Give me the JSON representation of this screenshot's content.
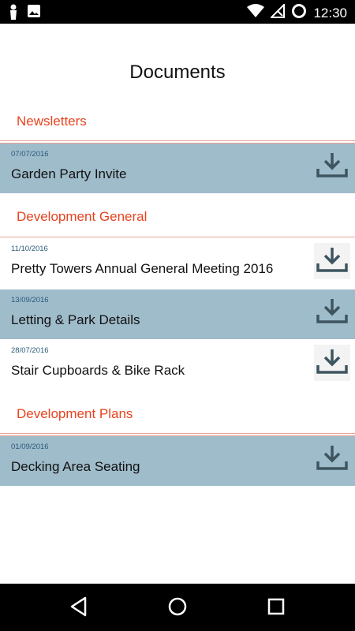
{
  "status_bar": {
    "time": "12:30",
    "left_icons": [
      "person-icon",
      "image-icon"
    ],
    "right_icons": [
      "wifi-icon",
      "no-signal-icon",
      "sync-icon"
    ]
  },
  "page": {
    "title": "Documents"
  },
  "sections": [
    {
      "title": "Newsletters",
      "documents": [
        {
          "date": "07/07/2016",
          "name": "Garden Party Invite"
        }
      ]
    },
    {
      "title": "Development General",
      "documents": [
        {
          "date": "11/10/2016",
          "name": "Pretty Towers Annual General Meeting 2016"
        },
        {
          "date": "13/09/2016",
          "name": "Letting & Park Details"
        },
        {
          "date": "28/07/2016",
          "name": "Stair Cupboards & Bike Rack"
        }
      ]
    },
    {
      "title": "Development Plans",
      "documents": [
        {
          "date": "01/09/2016",
          "name": "Decking Area Seating"
        }
      ]
    }
  ],
  "nav_bar": {
    "buttons": [
      "back-icon",
      "home-icon",
      "recents-icon"
    ]
  },
  "colors": {
    "section_header": "#e8431f",
    "row_shaded": "#9fbccb",
    "row_plain": "#ffffff",
    "date_text": "#2a5a78",
    "download_icon": "#3e5560"
  }
}
